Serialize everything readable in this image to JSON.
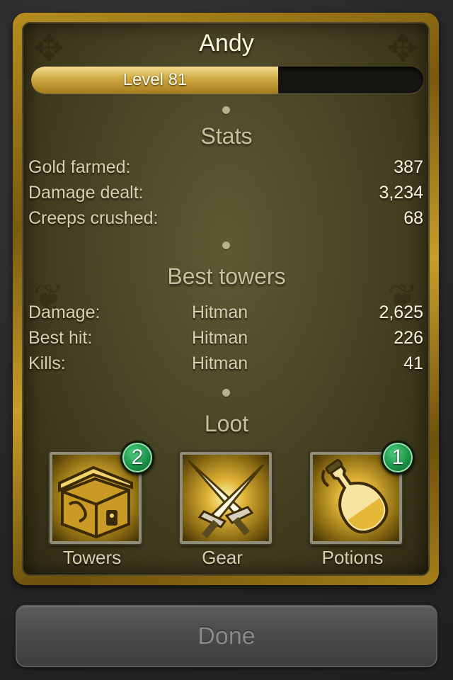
{
  "player": {
    "name": "Andy",
    "level_label": "Level 81",
    "level_progress": 0.63
  },
  "stats": {
    "title": "Stats",
    "rows": [
      {
        "label": "Gold farmed:",
        "value": "387"
      },
      {
        "label": "Damage dealt:",
        "value": "3,234"
      },
      {
        "label": "Creeps crushed:",
        "value": "68"
      }
    ]
  },
  "best_towers": {
    "title": "Best towers",
    "rows": [
      {
        "label": "Damage:",
        "tower": "Hitman",
        "value": "2,625"
      },
      {
        "label": "Best hit:",
        "tower": "Hitman",
        "value": "226"
      },
      {
        "label": "Kills:",
        "tower": "Hitman",
        "value": "41"
      }
    ]
  },
  "loot": {
    "title": "Loot",
    "items": [
      {
        "label": "Towers",
        "icon": "treasure-chest-icon",
        "badge": "2"
      },
      {
        "label": "Gear",
        "icon": "crossed-swords-icon",
        "badge": ""
      },
      {
        "label": "Potions",
        "icon": "potion-bottle-icon",
        "badge": "1"
      }
    ]
  },
  "done_label": "Done",
  "colors": {
    "gold": "#cfa83f",
    "badge_green": "#199046",
    "text_light": "#d7cfae"
  }
}
